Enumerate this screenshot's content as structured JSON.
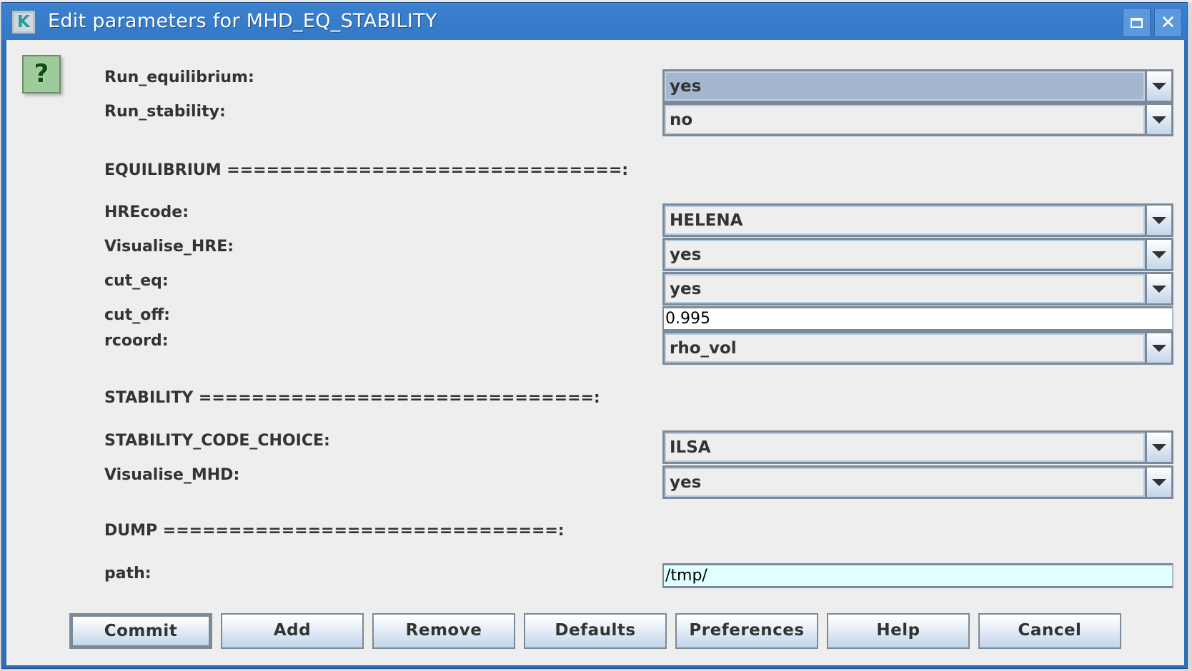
{
  "window": {
    "title": "Edit parameters for MHD_EQ_STABILITY",
    "app_icon_glyph": "K",
    "maximize_icon": "maximize-icon",
    "close_icon_glyph": "✕"
  },
  "help_icon_glyph": "?",
  "params": {
    "run_equilibrium": {
      "label": "Run_equilibrium:",
      "value": "yes",
      "type": "combo",
      "selected": true
    },
    "run_stability": {
      "label": "Run_stability:",
      "value": "no",
      "type": "combo"
    }
  },
  "sections": {
    "equilibrium": "EQUILIBRIUM ==============================:",
    "stability": "STABILITY ==============================:",
    "dump": "DUMP ==============================:"
  },
  "equilibrium": {
    "hrecode": {
      "label": "HREcode:",
      "value": "HELENA"
    },
    "visualise_hre": {
      "label": "Visualise_HRE:",
      "value": "yes"
    },
    "cut_eq": {
      "label": "cut_eq:",
      "value": "yes"
    },
    "cut_off": {
      "label": "cut_off:",
      "value": "0.995"
    },
    "rcoord": {
      "label": "rcoord:",
      "value": "rho_vol"
    }
  },
  "stability": {
    "code_choice": {
      "label": "STABILITY_CODE_CHOICE:",
      "value": "ILSA"
    },
    "visualise_mhd": {
      "label": "Visualise_MHD:",
      "value": "yes"
    }
  },
  "dump": {
    "path": {
      "label": "path:",
      "value": "/tmp/"
    }
  },
  "buttons": {
    "commit": "Commit",
    "add": "Add",
    "remove": "Remove",
    "defaults": "Defaults",
    "preferences": "Preferences",
    "help": "Help",
    "cancel": "Cancel"
  },
  "colors": {
    "titlebar": "#3579c6",
    "selected_combo": "#a3b8cf",
    "path_field_bg": "#e0ffff",
    "content_bg": "#eeeeee"
  }
}
